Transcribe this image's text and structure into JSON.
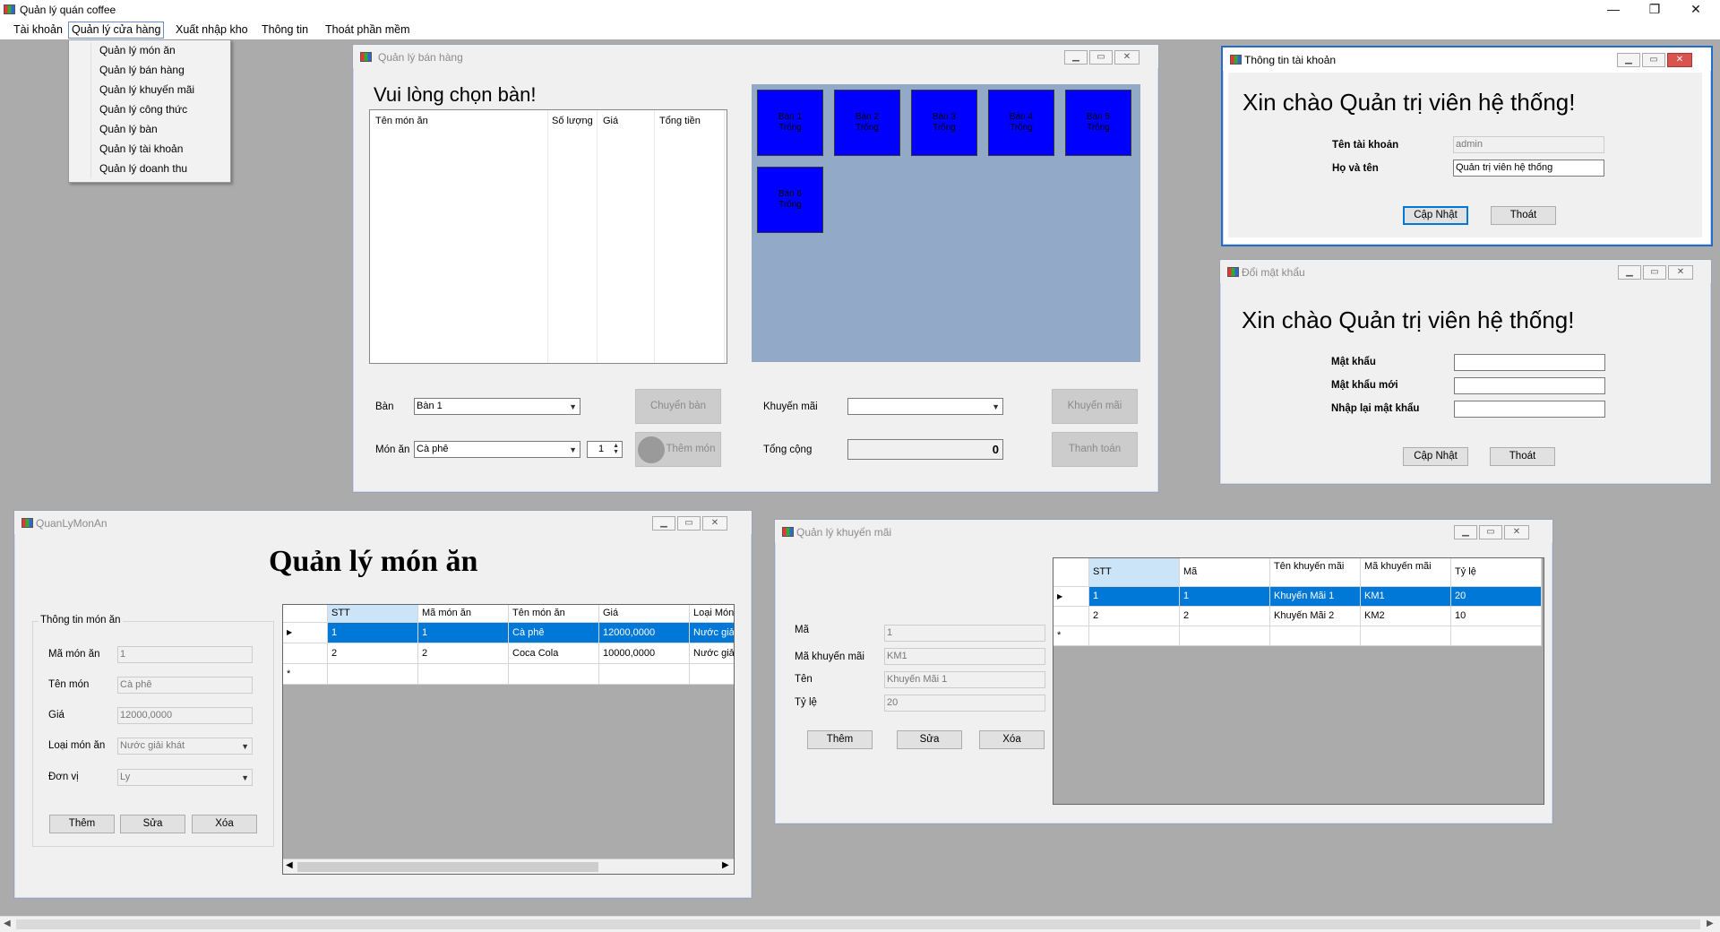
{
  "app": {
    "title": "Quản lý quán coffee",
    "minimize": "—",
    "maximize": "❐",
    "close": "✕"
  },
  "menu": {
    "items": [
      "Tài khoản",
      "Quản lý cửa hàng",
      "Xuất nhập kho",
      "Thông tin",
      "Thoát phần mềm"
    ],
    "dropdown": [
      "Quản lý món ăn",
      "Quản lý bán hàng",
      "Quản lý khuyến mãi",
      "Quản lý công thức",
      "Quản lý bàn",
      "Quản lý tài khoản",
      "Quản lý doanh thu"
    ]
  },
  "sales": {
    "title": "Quản lý bán hàng",
    "heading": "Vui lòng chọn bàn!",
    "columns": [
      "Tên món ăn",
      "Số lượng",
      "Giá",
      "Tổng tiền"
    ],
    "tables": [
      {
        "name": "Bàn 1",
        "status": "Trống"
      },
      {
        "name": "Bàn 2",
        "status": "Trống"
      },
      {
        "name": "Bàn 3",
        "status": "Trống"
      },
      {
        "name": "Bàn 4",
        "status": "Trống"
      },
      {
        "name": "Bàn 5",
        "status": "Trống"
      },
      {
        "name": "Bàn 6",
        "status": "Trống"
      }
    ],
    "ban_label": "Bàn",
    "ban_value": "Bàn 1",
    "mon_label": "Món ăn",
    "mon_value": "Cà phê",
    "qty": "1",
    "btn_chuyen": "Chuyển bàn",
    "btn_them_mon": "Thêm món",
    "km_label": "Khuyến mãi",
    "km_value": "",
    "tong_label": "Tổng cộng",
    "tong_value": "0",
    "btn_km": "Khuyến mãi",
    "btn_thanh_toan": "Thanh toán",
    "table_area_color": "#93a9c8",
    "table_color": "#0000ff"
  },
  "account": {
    "title": "Thông tin tài khoản",
    "heading": "Xin chào Quản trị viên hệ thống!",
    "user_label": "Tên tài khoản",
    "user_value": "admin",
    "name_label": "Họ và tên",
    "name_value": "Quản trị viên hệ thống",
    "btn_update": "Cập Nhật",
    "btn_exit": "Thoát"
  },
  "password": {
    "title": "Đổi mật khẩu",
    "heading": "Xin chào Quản trị viên hệ thống!",
    "pw_label": "Mật khẩu",
    "new_label": "Mật khẩu mới",
    "confirm_label": "Nhập lại mật khẩu",
    "btn_update": "Cập Nhật",
    "btn_exit": "Thoát"
  },
  "food": {
    "title": "QuanLyMonAn",
    "heading": "Quản lý món ăn",
    "group": "Thông tin món ăn",
    "ma_label": "Mã món ăn",
    "ma_value": "1",
    "ten_label": "Tên món",
    "ten_value": "Cà phê",
    "gia_label": "Giá",
    "gia_value": "12000,0000",
    "loai_label": "Loại món ăn",
    "loai_value": "Nước giải khát",
    "dv_label": "Đơn vị",
    "dv_value": "Ly",
    "btn_them": "Thêm",
    "btn_sua": "Sửa",
    "btn_xoa": "Xóa",
    "columns": [
      "STT",
      "Mã món ăn",
      "Tên món ăn",
      "Giá",
      "Loại Món"
    ],
    "rows": [
      [
        "1",
        "1",
        "Cà phê",
        "12000,0000",
        "Nước giải"
      ],
      [
        "2",
        "2",
        "Coca Cola",
        "10000,0000",
        "Nước giải"
      ]
    ]
  },
  "promo": {
    "title": "Quản lý khuyến mãi",
    "ma_label": "Mã",
    "ma_value": "1",
    "makm_label": "Mã khuyến mãi",
    "makm_value": "KM1",
    "ten_label": "Tên",
    "ten_value": "Khuyến Mãi 1",
    "tyle_label": "Tỷ lệ",
    "tyle_value": "20",
    "btn_them": "Thêm",
    "btn_sua": "Sửa",
    "btn_xoa": "Xóa",
    "columns": [
      "STT",
      "Mã",
      "Tên khuyến mãi",
      "Mã khuyến mãi",
      "Tỷ lệ"
    ],
    "rows": [
      [
        "1",
        "1",
        "Khuyến Mãi 1",
        "KM1",
        "20"
      ],
      [
        "2",
        "2",
        "Khuyến Mãi 2",
        "KM2",
        "10"
      ]
    ]
  }
}
